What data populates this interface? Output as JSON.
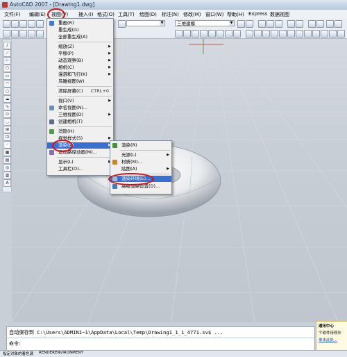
{
  "titlebar": {
    "title": "AutoCAD 2007 - [Drawing1.dwg]"
  },
  "menubar": {
    "items": [
      "文件(F)",
      "编辑(E)",
      "视图(V)",
      "插入(I)",
      "格式(O)",
      "工具(T)",
      "绘图(D)",
      "标注(N)",
      "修改(M)",
      "窗口(W)",
      "帮助(H)",
      "Express",
      "数据视图"
    ]
  },
  "toolbar": {
    "layer_combo": "",
    "workspace_combo": "三维建模"
  },
  "view_menu": {
    "items": [
      {
        "label": "重画(R)",
        "shortcut": "",
        "submenu": false,
        "icon": "redraw-icon"
      },
      {
        "label": "重生成(G)",
        "shortcut": "",
        "submenu": false,
        "icon": ""
      },
      {
        "label": "全部重生成(A)",
        "shortcut": "",
        "submenu": false,
        "icon": ""
      },
      {
        "label": "缩放(Z)",
        "shortcut": "",
        "submenu": true,
        "icon": ""
      },
      {
        "label": "平移(P)",
        "shortcut": "",
        "submenu": true,
        "icon": ""
      },
      {
        "label": "动态观察(B)",
        "shortcut": "",
        "submenu": true,
        "icon": ""
      },
      {
        "label": "相机(C)",
        "shortcut": "",
        "submenu": true,
        "icon": ""
      },
      {
        "label": "漫游和飞行(K)",
        "shortcut": "",
        "submenu": true,
        "icon": ""
      },
      {
        "label": "鸟瞰视图(W)",
        "shortcut": "",
        "submenu": false,
        "icon": ""
      },
      {
        "label": "清除屏幕(C)",
        "shortcut": "CTRL+0",
        "submenu": false,
        "icon": ""
      },
      {
        "label": "视口(V)",
        "shortcut": "",
        "submenu": true,
        "icon": ""
      },
      {
        "label": "命名视图(N)...",
        "shortcut": "",
        "submenu": false,
        "icon": "named-view-icon"
      },
      {
        "label": "三维视图(D)",
        "shortcut": "",
        "submenu": true,
        "icon": ""
      },
      {
        "label": "创建相机(T)",
        "shortcut": "",
        "submenu": false,
        "icon": "camera-icon"
      },
      {
        "label": "消隐(H)",
        "shortcut": "",
        "submenu": false,
        "icon": "hide-icon"
      },
      {
        "label": "视觉样式(S)",
        "shortcut": "",
        "submenu": true,
        "icon": ""
      },
      {
        "label": "渲染(E)",
        "shortcut": "",
        "submenu": true,
        "icon": ""
      },
      {
        "label": "运动路径动画(M)...",
        "shortcut": "",
        "submenu": false,
        "icon": "motion-path-icon"
      },
      {
        "label": "显示(L)",
        "shortcut": "",
        "submenu": true,
        "icon": ""
      },
      {
        "label": "工具栏(O)...",
        "shortcut": "",
        "submenu": false,
        "icon": ""
      }
    ]
  },
  "render_submenu": {
    "items": [
      {
        "label": "渲染(R)",
        "submenu": false,
        "icon": "render-icon"
      },
      {
        "label": "光源(L)",
        "submenu": true,
        "icon": ""
      },
      {
        "label": "材质(M)...",
        "submenu": false,
        "icon": "materials-icon"
      },
      {
        "label": "贴图(A)",
        "submenu": true,
        "icon": ""
      },
      {
        "label": "渲染环境(E)...",
        "submenu": false,
        "icon": "render-env-icon"
      },
      {
        "label": "高级渲染设置(D)...",
        "submenu": false,
        "icon": "advanced-render-icon"
      }
    ]
  },
  "command": {
    "autosave_line": "自动保存到 C:\\Users\\ADMINI~1\\AppData\\Local\\Temp\\Drawing1_1_1_4771.sv$ ...",
    "prompt": "命令:"
  },
  "statusbar": {
    "left_text": "指定对象的着色源",
    "command_name": "RENDERENVIRONMENT"
  },
  "tray": {
    "title": "通讯中心",
    "line1": "个软件待修补",
    "line2": "单击此处..."
  },
  "colors": {
    "highlight": "#3a6fd1",
    "annotation_ring": "#d0101a"
  }
}
